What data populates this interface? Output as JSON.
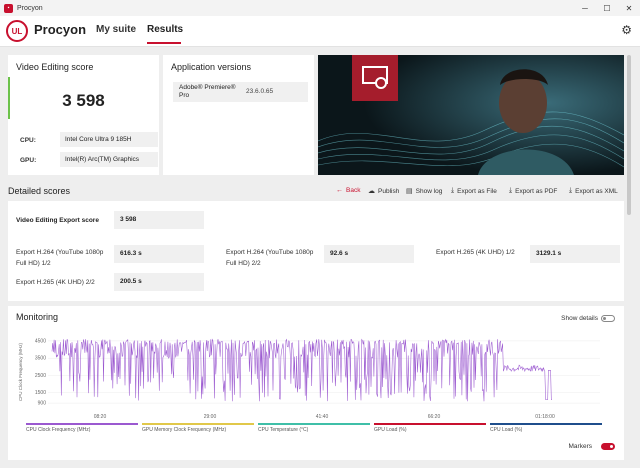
{
  "window": {
    "title": "Procyon",
    "min": "─",
    "max": "☐",
    "close": "✕"
  },
  "nav": {
    "logo": "UL",
    "brand": "Procyon",
    "tabs": [
      {
        "label": "My suite"
      },
      {
        "label": "Results"
      }
    ],
    "active_tab": "Results"
  },
  "score": {
    "title": "Video Editing score",
    "value": "3 598",
    "cpu_label": "CPU:",
    "cpu_value": "Intel Core Ultra 9 185H",
    "gpu_label": "GPU:",
    "gpu_value": "Intel(R) Arc(TM) Graphics"
  },
  "apps": {
    "title": "Application versions",
    "name": "Adobe® Premiere® Pro",
    "version": "23.6.0.65"
  },
  "detailed": {
    "title": "Detailed scores",
    "toolbar": [
      {
        "icon": "←",
        "label": "Back",
        "accent": true
      },
      {
        "icon": "☁",
        "label": "Publish"
      },
      {
        "icon": "▤",
        "label": "Show log"
      },
      {
        "icon": "⤓",
        "label": "Export as File"
      },
      {
        "icon": "⤓",
        "label": "Export as PDF"
      },
      {
        "icon": "⤓",
        "label": "Export as XML"
      }
    ],
    "rows": [
      {
        "label": "Video Editing Export score",
        "value": "3 598"
      },
      {
        "label": "Export H.264 (YouTube 1080p Full HD) 1/2",
        "value": "616.3 s"
      },
      {
        "label": "Export H.264 (YouTube 1080p Full HD) 2/2",
        "value": "92.6 s"
      },
      {
        "label": "Export H.265 (4K UHD) 1/2",
        "value": "3129.1 s"
      },
      {
        "label": "Export H.265 (4K UHD) 2/2",
        "value": "200.5 s"
      }
    ]
  },
  "monitoring": {
    "title": "Monitoring",
    "show_details": "Show details",
    "markers": "Markers",
    "chart_data": {
      "type": "line",
      "ylabel": "CPU Clock Frequency (MHz)",
      "yticks": [
        "4500",
        "3500",
        "2500",
        "1500",
        "900"
      ],
      "xticks": [
        "08:20",
        "29:00",
        "41:40",
        "66:20",
        "01:18:00"
      ],
      "ylim": [
        500,
        4900
      ],
      "legend": [
        {
          "name": "CPU Clock Frequency (MHz)",
          "color": "#9b59d0"
        },
        {
          "name": "GPU Memory Clock Frequency (MHz)",
          "color": "#e1c84a"
        },
        {
          "name": "CPU Temperature (°C)",
          "color": "#3fbfa8"
        },
        {
          "name": "GPU Load (%)",
          "color": "#c8102e"
        },
        {
          "name": "CPU Load (%)",
          "color": "#1f4e8c"
        }
      ],
      "series": [
        {
          "name": "CPU Clock Frequency (MHz)",
          "color": "#9b59d0"
        }
      ]
    }
  },
  "colors": {
    "accent": "#c8102e",
    "score_accent": "#6cc24a",
    "series": "#9b59d0"
  }
}
